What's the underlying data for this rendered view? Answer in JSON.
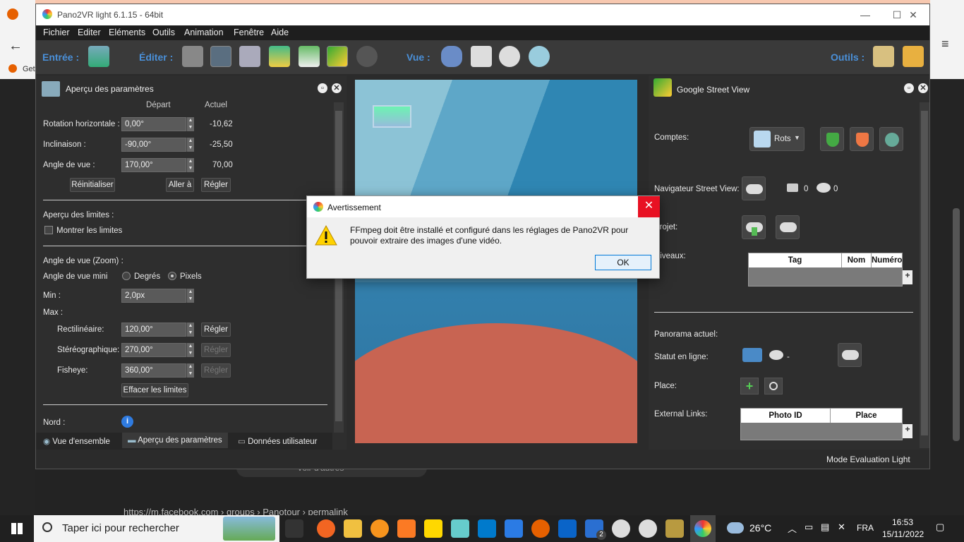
{
  "browser": {
    "tab_label": "Get",
    "url_text": "https://m.facebook.com › groups › Panotour › permalink",
    "pill_text": "Voir d'autres"
  },
  "app": {
    "title": "Pano2VR light 6.1.15 - 64bit",
    "menu": [
      "Fichier",
      "Editer",
      "Eléments",
      "Outils",
      "Animation",
      "Fenêtre",
      "Aide"
    ],
    "toolbar": {
      "input_label": "Entrée :",
      "edit_label": "Éditer :",
      "view_label": "Vue :",
      "tools_label": "Outils :"
    },
    "status": "Mode Evaluation Light"
  },
  "params_panel": {
    "title": "Aperçu des paramètres",
    "col_start": "Départ",
    "col_current": "Actuel",
    "rows": [
      {
        "label": "Rotation horizontale :",
        "value": "0,00°",
        "current": "-10,62"
      },
      {
        "label": "Inclinaison :",
        "value": "-90,00°",
        "current": "-25,50"
      },
      {
        "label": "Angle de vue :",
        "value": "170,00°",
        "current": "70,00"
      }
    ],
    "reset_btn": "Réinitialiser",
    "goto_btn": "Aller à",
    "set_btn": "Régler",
    "limits_title": "Aperçu des limites :",
    "show_limits": "Montrer les limites",
    "zoom_title": "Angle de vue (Zoom) :",
    "min_fov_label": "Angle de vue mini",
    "degrees": "Degrés",
    "pixels": "Pixels",
    "min_label": "Min :",
    "min_value": "2,0px",
    "max_label": "Max :",
    "rect_label": "Rectilinéaire:",
    "rect_value": "120,00°",
    "stereo_label": "Stéréographique:",
    "stereo_value": "270,00°",
    "fisheye_label": "Fisheye:",
    "fisheye_value": "360,00°",
    "clear_btn": "Effacer les limites",
    "north_label": "Nord :",
    "info_glyph": "i",
    "tabs": [
      "Vue d'ensemble",
      "Aperçu des paramètres",
      "Données utilisateur"
    ]
  },
  "gsv": {
    "title": "Google Street View",
    "accounts_label": "Comptes:",
    "account_name": "Rots",
    "navigator_label": "Navigateur Street View:",
    "photo_count": "0",
    "view_count": "0",
    "project_label": "Projet:",
    "levels_label": "Niveaux:",
    "levels_cols": [
      "Tag",
      "Nom",
      "Numéro"
    ],
    "current_pano": "Panorama actuel:",
    "online_status": "Statut en ligne:",
    "online_value": "-",
    "place_label": "Place:",
    "links_label": "External Links:",
    "links_cols": [
      "Photo ID",
      "Place"
    ],
    "plus": "+"
  },
  "dialog": {
    "title": "Avertissement",
    "message": "FFmpeg doit être installé et configuré dans les réglages de Pano2VR pour pouvoir extraire des images d'une vidéo.",
    "ok": "OK",
    "close": "✕"
  },
  "taskbar": {
    "search_placeholder": "Taper ici pour rechercher",
    "weather": "26°C",
    "lang": "FRA",
    "time": "16:53",
    "date": "15/11/2022",
    "badge": "2"
  }
}
